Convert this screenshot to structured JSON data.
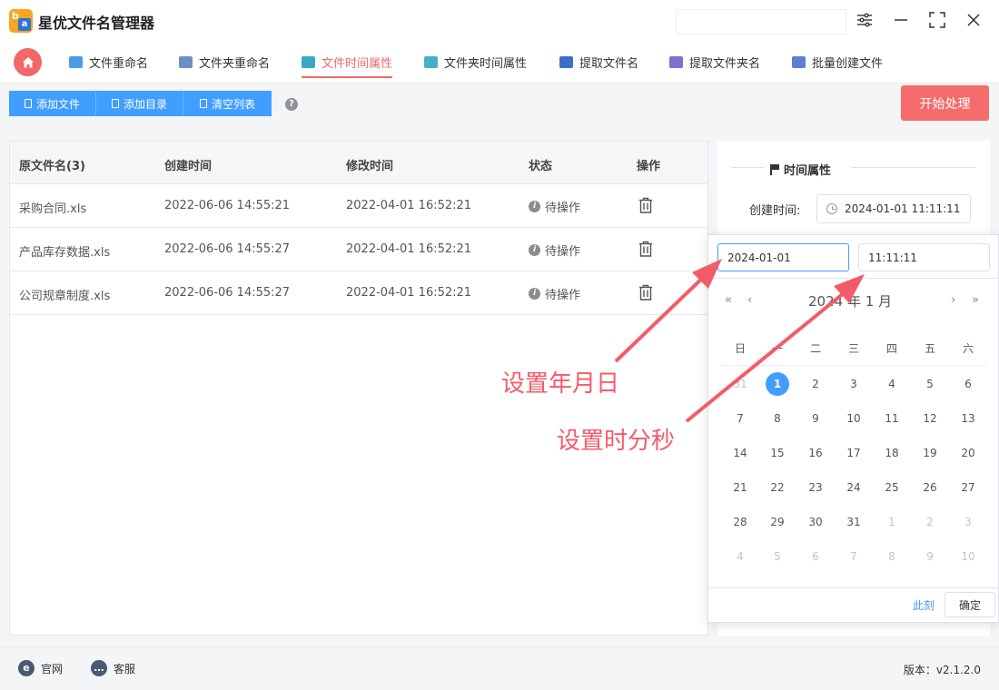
{
  "app": {
    "title": "星优文件名管理器",
    "logo_b": "b",
    "logo_a": "a"
  },
  "nav": {
    "tabs": [
      {
        "label": "文件重命名",
        "color": "#4a9be8"
      },
      {
        "label": "文件夹重命名",
        "color": "#6f8fc2"
      },
      {
        "label": "文件时间属性",
        "color": "#3aa9c9"
      },
      {
        "label": "文件夹时间属性",
        "color": "#43b0c7"
      },
      {
        "label": "提取文件名",
        "color": "#3d6fc9"
      },
      {
        "label": "提取文件夹名",
        "color": "#7b6fd0"
      },
      {
        "label": "批量创建文件",
        "color": "#5b7fd6"
      }
    ]
  },
  "toolbar": {
    "add_file": "添加文件",
    "add_dir": "添加目录",
    "clear_list": "清空列表",
    "help": "?",
    "start": "开始处理"
  },
  "table": {
    "headers": [
      "原文件名(3)",
      "创建时间",
      "修改时间",
      "状态",
      "操作"
    ],
    "rows": [
      {
        "name": "采购合同.xls",
        "created": "2022-06-06 14:55:21",
        "modified": "2022-04-01 16:52:21",
        "status": "待操作"
      },
      {
        "name": "产品库存数据.xls",
        "created": "2022-06-06 14:55:27",
        "modified": "2022-04-01 16:52:21",
        "status": "待操作"
      },
      {
        "name": "公司规章制度.xls",
        "created": "2022-06-06 14:55:27",
        "modified": "2022-04-01 16:52:21",
        "status": "待操作"
      }
    ]
  },
  "panel": {
    "title": "时间属性",
    "created_label": "创建时间:",
    "created_value": "2024-01-01 11:11:11"
  },
  "picker": {
    "date_value": "2024-01-01",
    "time_value": "11:11:11",
    "month_label": "2024 年  1 月",
    "weekdays": [
      "日",
      "一",
      "二",
      "三",
      "四",
      "五",
      "六"
    ],
    "weeks": [
      [
        "31",
        "1",
        "2",
        "3",
        "4",
        "5",
        "6"
      ],
      [
        "7",
        "8",
        "9",
        "10",
        "11",
        "12",
        "13"
      ],
      [
        "14",
        "15",
        "16",
        "17",
        "18",
        "19",
        "20"
      ],
      [
        "21",
        "22",
        "23",
        "24",
        "25",
        "26",
        "27"
      ],
      [
        "28",
        "29",
        "30",
        "31",
        "1",
        "2",
        "3"
      ],
      [
        "4",
        "5",
        "6",
        "7",
        "8",
        "9",
        "10"
      ]
    ],
    "now": "此刻",
    "ok": "确定"
  },
  "annotations": {
    "set_date": "设置年月日",
    "set_time": "设置时分秒"
  },
  "footer": {
    "website": "官网",
    "support": "客服",
    "version": "版本：v2.1.2.0"
  }
}
